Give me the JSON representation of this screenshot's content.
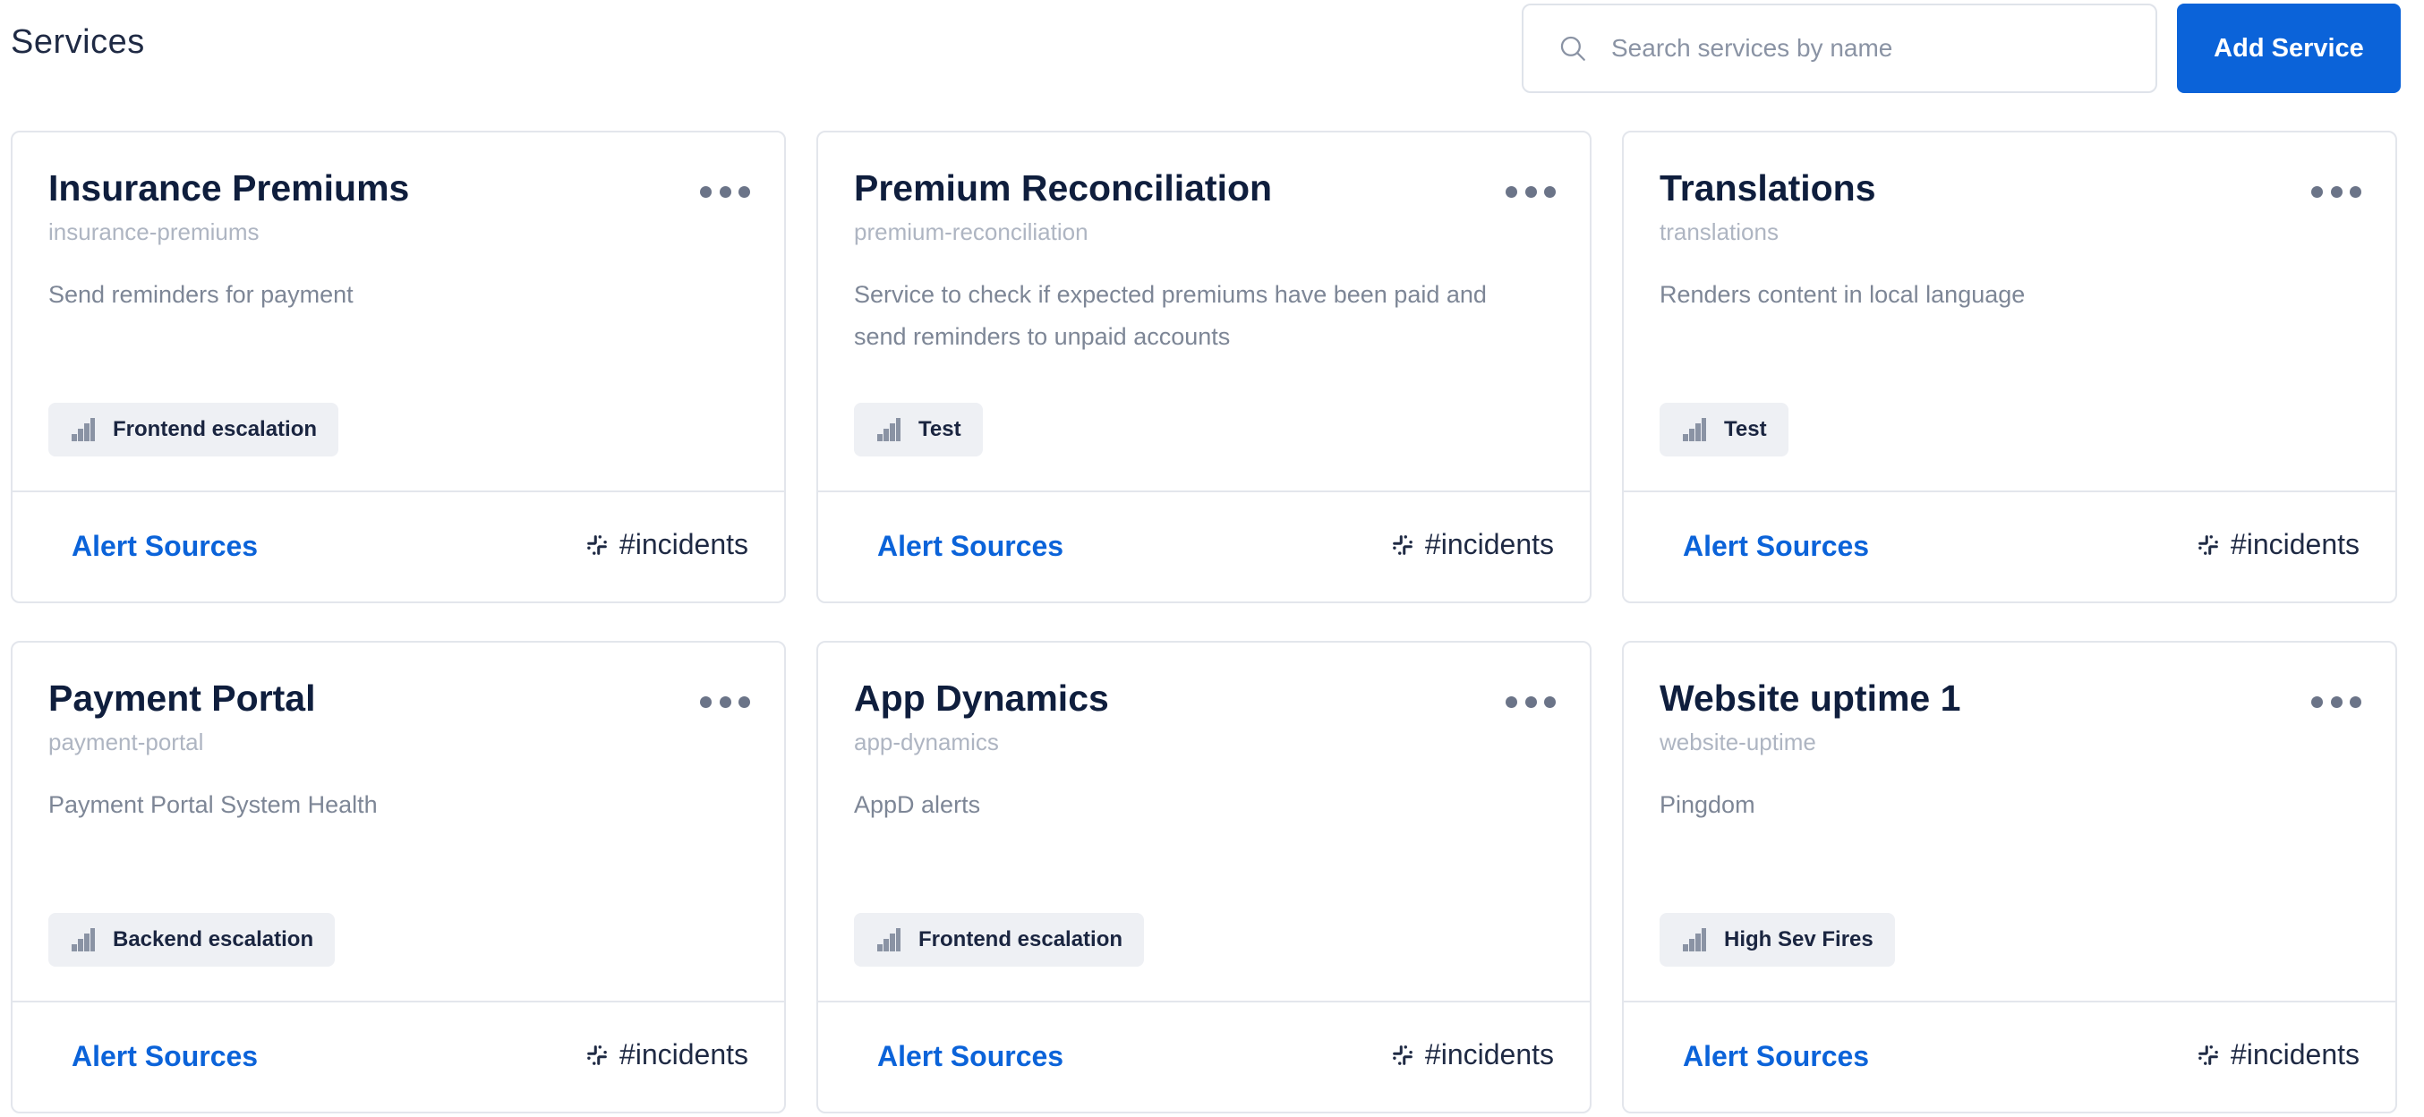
{
  "header": {
    "title": "Services",
    "search_placeholder": "Search services by name",
    "add_button_label": "Add Service"
  },
  "colors": {
    "accent": "#0b63d9",
    "card_border": "#e3e6ec",
    "tag_background": "#eef0f4"
  },
  "cards": [
    {
      "name": "Insurance Premiums",
      "slug": "insurance-premiums",
      "description": "Send reminders for payment",
      "policy": "Frontend escalation",
      "alert_sources_label": "Alert Sources",
      "channel": "#incidents"
    },
    {
      "name": "Premium Reconciliation",
      "slug": "premium-reconciliation",
      "description": "Service to check if expected premiums have been paid and send reminders to unpaid accounts",
      "policy": "Test",
      "alert_sources_label": "Alert Sources",
      "channel": "#incidents"
    },
    {
      "name": "Translations",
      "slug": "translations",
      "description": "Renders content in local language",
      "policy": "Test",
      "alert_sources_label": "Alert Sources",
      "channel": "#incidents"
    },
    {
      "name": "Payment Portal",
      "slug": "payment-portal",
      "description": "Payment Portal System Health",
      "policy": "Backend escalation",
      "alert_sources_label": "Alert Sources",
      "channel": "#incidents"
    },
    {
      "name": "App Dynamics",
      "slug": "app-dynamics",
      "description": "AppD alerts",
      "policy": "Frontend escalation",
      "alert_sources_label": "Alert Sources",
      "channel": "#incidents"
    },
    {
      "name": "Website uptime 1",
      "slug": "website-uptime",
      "description": "Pingdom",
      "policy": "High Sev Fires",
      "alert_sources_label": "Alert Sources",
      "channel": "#incidents"
    }
  ]
}
